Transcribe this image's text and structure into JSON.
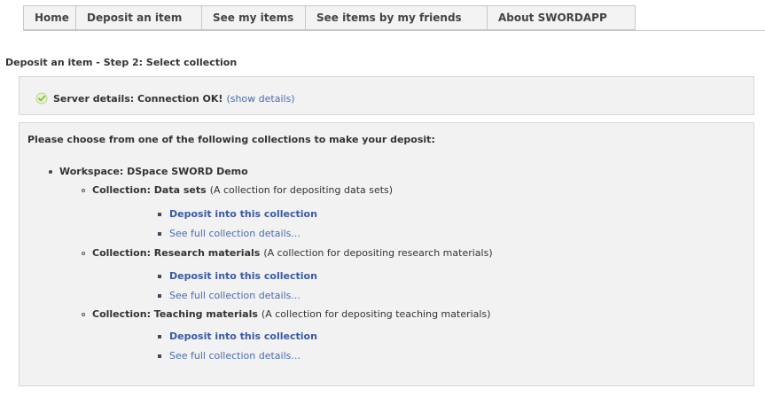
{
  "nav": {
    "tabs": [
      {
        "label": "Home"
      },
      {
        "label": "Deposit an item"
      },
      {
        "label": "See my items"
      },
      {
        "label": "See items by my friends"
      },
      {
        "label": "About SWORDAPP"
      }
    ]
  },
  "page_title": "Deposit an item - Step 2: Select collection",
  "server": {
    "status_label": "Server details: Connection OK!",
    "show_details_label": "(show details)",
    "icon": "check-icon"
  },
  "collections_panel": {
    "intro": "Please choose from one of the following collections to make your deposit:",
    "workspace_label": "Workspace: DSpace SWORD Demo",
    "collections": [
      {
        "name": "Collection: Data sets",
        "description": "(A collection for depositing data sets)",
        "deposit_label": "Deposit into this collection",
        "details_label": "See full collection details..."
      },
      {
        "name": "Collection: Research materials",
        "description": "(A collection for depositing research materials)",
        "deposit_label": "Deposit into this collection",
        "details_label": "See full collection details..."
      },
      {
        "name": "Collection: Teaching materials",
        "description": "(A collection for depositing teaching materials)",
        "deposit_label": "Deposit into this collection",
        "details_label": "See full collection details..."
      }
    ]
  },
  "colors": {
    "link": "#3b5aa6",
    "panel_bg": "#f2f2f2",
    "check_green": "#9bcf4a"
  }
}
